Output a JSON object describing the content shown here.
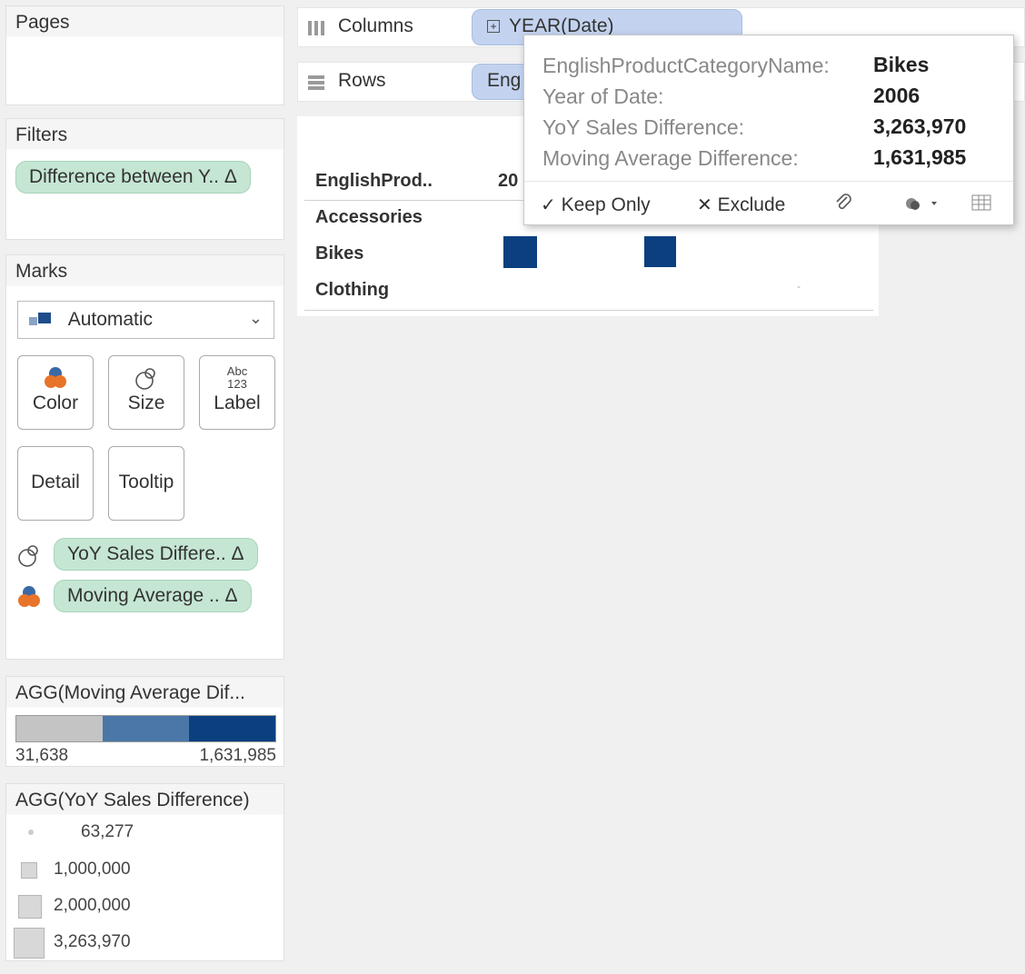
{
  "cards": {
    "pages_title": "Pages",
    "filters_title": "Filters",
    "marks_title": "Marks"
  },
  "filters": {
    "pill": "Difference between Y.. Δ"
  },
  "marks": {
    "mark_type": "Automatic",
    "buttons": {
      "color": "Color",
      "size": "Size",
      "label": "Label",
      "detail": "Detail",
      "tooltip": "Tooltip"
    },
    "label_icon_text": [
      "Abc",
      "123"
    ],
    "fields": [
      {
        "text": "YoY Sales Differe.. Δ",
        "icon": "size-icon"
      },
      {
        "text": "Moving Average .. Δ",
        "icon": "color-icon"
      }
    ]
  },
  "legend_color": {
    "title": "AGG(Moving Average Dif...",
    "min": "31,638",
    "max": "1,631,985",
    "colors": [
      "#c4c4c4",
      "#4a77a8",
      "#0b3f80"
    ]
  },
  "legend_size": {
    "title": "AGG(YoY Sales Difference)",
    "items": [
      "63,277",
      "1,000,000",
      "2,000,000",
      "3,263,970"
    ]
  },
  "shelves": {
    "columns_label": "Columns",
    "columns_pill": "YEAR(Date)",
    "rows_label": "Rows",
    "rows_pill": "Eng"
  },
  "view": {
    "header": "EnglishProd..",
    "year_partial": "20",
    "rows": [
      "Accessories",
      "Bikes",
      "Clothing"
    ],
    "marker": "-"
  },
  "tooltip": {
    "rows": [
      {
        "label": "EnglishProductCategoryName:",
        "value": "Bikes"
      },
      {
        "label": "Year of Date:",
        "value": "2006"
      },
      {
        "label": "YoY Sales Difference:",
        "value": "3,263,970"
      },
      {
        "label": "Moving Average Difference:",
        "value": "1,631,985"
      }
    ],
    "keep_only": "Keep Only",
    "exclude": "Exclude"
  },
  "colors": {
    "mark": "#0b3f80",
    "filter_pill": "#c5e6d3",
    "shelf_pill": "#c3d3ef"
  }
}
